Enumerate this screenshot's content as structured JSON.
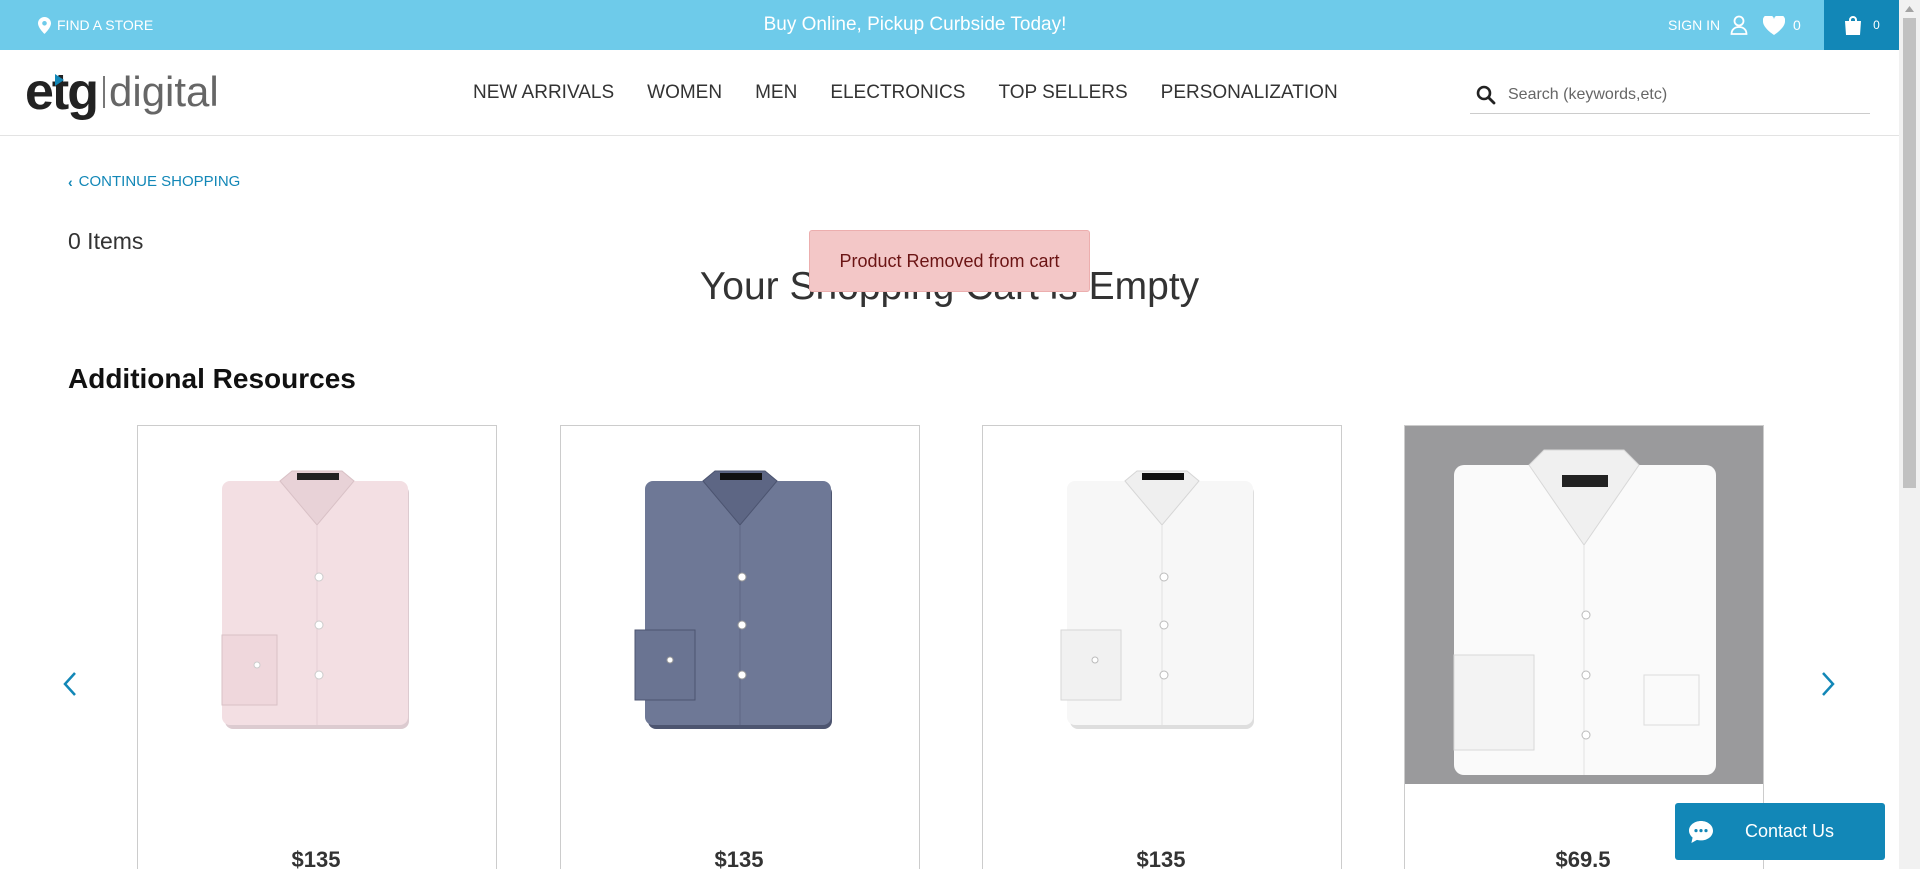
{
  "topbar": {
    "find_store": "FIND A STORE",
    "promo": "Buy Online, Pickup Curbside Today!",
    "sign_in": "SIGN IN",
    "wishlist_count": "0",
    "cart_count": "0"
  },
  "header": {
    "logo_etg": "etg",
    "logo_digital": "digital",
    "nav": [
      "NEW ARRIVALS",
      "WOMEN",
      "MEN",
      "ELECTRONICS",
      "TOP SELLERS",
      "PERSONALIZATION"
    ],
    "search_placeholder": "Search (keywords,etc)"
  },
  "main": {
    "continue_shopping": "CONTINUE SHOPPING",
    "items_count": "0 Items",
    "empty_title": "Your Shopping Cart is Empty",
    "toast": "Product Removed from cart",
    "additional_resources": "Additional Resources"
  },
  "products": [
    {
      "price": "$135",
      "shirt_color": "#f3dfe3",
      "collar_shadow": "#d9c1c6",
      "bg": "#ffffff"
    },
    {
      "price": "$135",
      "shirt_color": "#6e7896",
      "collar_shadow": "#4c5470",
      "bg": "#ffffff"
    },
    {
      "price": "$135",
      "shirt_color": "#f7f7f7",
      "collar_shadow": "#dcdcdc",
      "bg": "#ffffff"
    },
    {
      "price": "$69.5",
      "shirt_color": "#fafafa",
      "collar_shadow": "#dedede",
      "bg": "#9a9a9c"
    }
  ],
  "contact_us": "Contact Us",
  "colors": {
    "topbar": "#6ecbea",
    "accent": "#1287b7",
    "toast_bg": "#f3c7c7"
  }
}
